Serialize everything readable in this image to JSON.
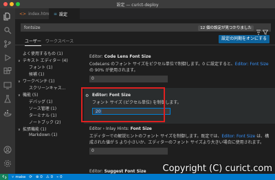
{
  "window": {
    "title": "設定 — curict-deploy",
    "traffic_colors": [
      "#ff5f57",
      "#febc2e",
      "#28c840"
    ]
  },
  "activity_bar": {
    "icons": [
      "files-icon",
      "search-icon",
      "source-control-icon",
      "run-debug-icon",
      "extensions-icon",
      "remote-explorer-icon",
      "testing-icon",
      "docker-icon",
      "account-icon",
      "manage-gear-icon"
    ]
  },
  "tabs": [
    {
      "label": "index.html",
      "icon": "<>",
      "active": false
    },
    {
      "label": "設定",
      "icon": "≡",
      "active": true
    }
  ],
  "search": {
    "query": "fontsize",
    "result_count": "12 個の設定が見つかりました"
  },
  "scope": {
    "user": "ユーザー",
    "workspace": "ワークスペース",
    "sync_button": "設定の同期をオンにする"
  },
  "toc": [
    {
      "label": "よく使用するもの (1)",
      "chevron": "",
      "indent": 0
    },
    {
      "label": "テキスト エディター (4)",
      "chevron": "∨",
      "indent": 0
    },
    {
      "label": "フォント (1)",
      "chevron": "",
      "indent": 1
    },
    {
      "label": "候補 (1)",
      "chevron": "",
      "indent": 1
    },
    {
      "label": "ワークベンチ (1)",
      "chevron": "∨",
      "indent": 0
    },
    {
      "label": "スクリーンキャス...",
      "chevron": "",
      "indent": 1
    },
    {
      "label": "機能 (5)",
      "chevron": "∨",
      "indent": 0
    },
    {
      "label": "デバッグ (1)",
      "chevron": "",
      "indent": 1
    },
    {
      "label": "ソース管理 (1)",
      "chevron": "",
      "indent": 1
    },
    {
      "label": "ターミナル (1)",
      "chevron": "",
      "indent": 1
    },
    {
      "label": "ノートブック (2)",
      "chevron": "",
      "indent": 1
    },
    {
      "label": "拡張機能 (1)",
      "chevron": "∨",
      "indent": 0
    },
    {
      "label": "Markdown (1)",
      "chevron": "",
      "indent": 1
    }
  ],
  "settings": {
    "codelens": {
      "prefix": "Editor: ",
      "title": "Code Lens Font Size",
      "desc_a": "CodeLens のフォント サイズをピクセル単位で制御します。0 に設定すると、",
      "desc_link": "Editor: Font Size",
      "desc_b": " の 90% が使用されます。",
      "value": "0"
    },
    "fontsize": {
      "prefix": "Editor: ",
      "title": "Font Size",
      "desc": "フォント サイズ (ピクセル単位) を制御します。",
      "value": "20"
    },
    "inlay": {
      "prefix": "Editor › Inlay Hints: ",
      "title": "Font Size",
      "desc_a": "エディターでの解説ヒントのフォント サイズを制御します。既定では、",
      "desc_link": "Editor: Font Size",
      "desc_b": " は、構成された値が 5 より小さいか、エディターのフォント サイズより大きい場合に使用されます。",
      "value": "0"
    },
    "suggest": {
      "prefix": "Editor: ",
      "title": "Suggest Font Size"
    }
  },
  "statusbar": {
    "branch": "make",
    "sync": "⟳",
    "errors": "⊗ 0",
    "warnings": "⚠ 0",
    "ports": "⌁ 0"
  },
  "watermark": "Copyright (C) curict.com"
}
